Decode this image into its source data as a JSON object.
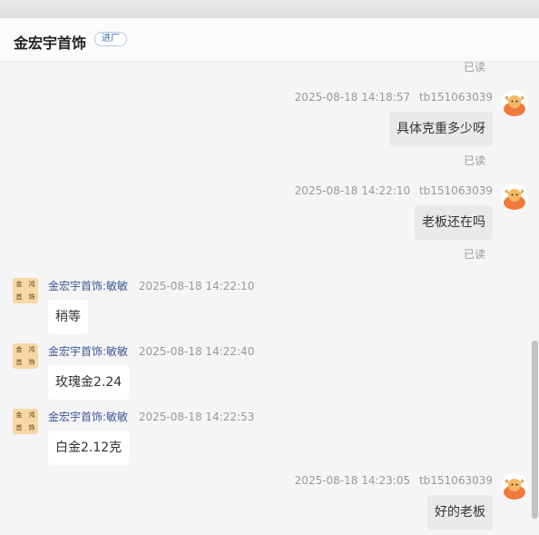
{
  "header": {
    "shop_name": "金宏宇首饰",
    "badge": "进厂"
  },
  "status": {
    "read": "已读"
  },
  "shop_avatar_chars": [
    "金",
    "鸿",
    "首",
    "饰"
  ],
  "messages": [
    {
      "time": "2025-08-18 14:18:57",
      "user": "tb151063039",
      "text": "具体克重多少呀"
    },
    {
      "time": "2025-08-18 14:22:10",
      "user": "tb151063039",
      "text": "老板还在吗"
    },
    {
      "nick": "金宏宇首饰:敏敏",
      "time": "2025-08-18 14:22:10",
      "text": "稍等"
    },
    {
      "nick": "金宏宇首饰:敏敏",
      "time": "2025-08-18 14:22:40",
      "text": "玫瑰金2.24"
    },
    {
      "nick": "金宏宇首饰:敏敏",
      "time": "2025-08-18 14:22:53",
      "text": "白金2.12克"
    },
    {
      "time": "2025-08-18 14:23:05",
      "user": "tb151063039",
      "text": "好的老板"
    }
  ],
  "colors": {
    "mine_bubble": "#e9e9e9",
    "theirs_bubble": "#ffffff",
    "nick": "#3e5a96",
    "avatar_bg": "#f7d7a6"
  }
}
